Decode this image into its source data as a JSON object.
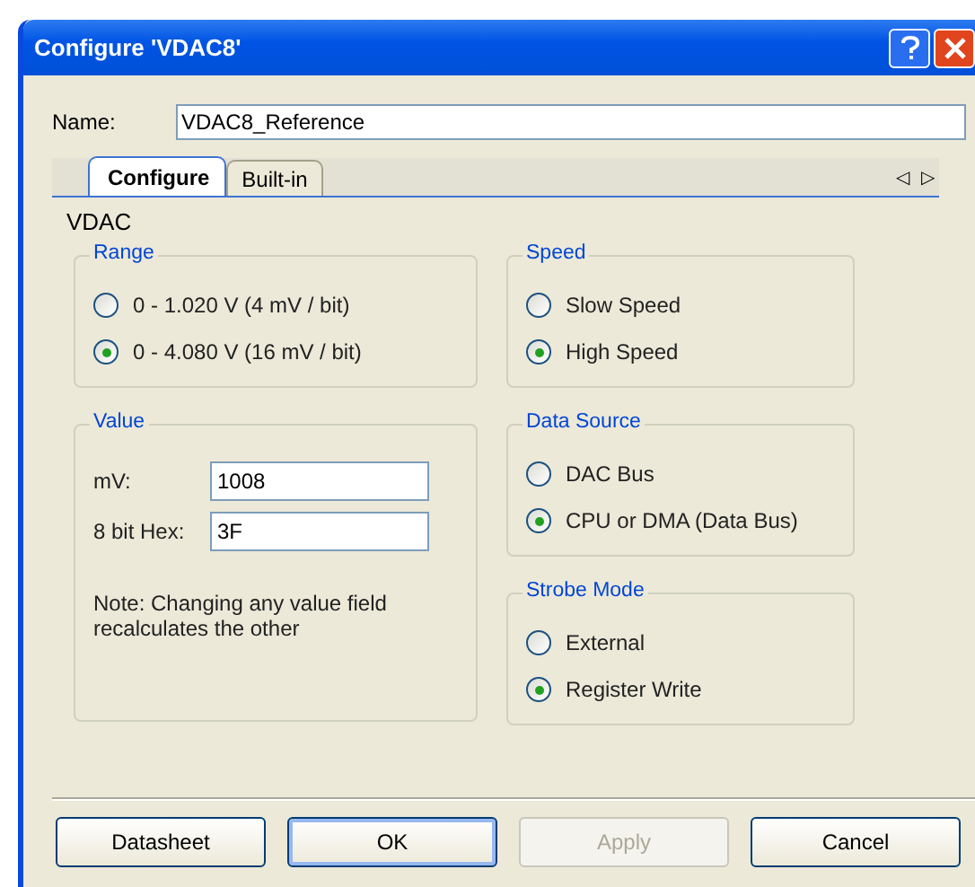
{
  "window": {
    "title": "Configure 'VDAC8'"
  },
  "name_field": {
    "label": "Name:",
    "value": "VDAC8_Reference"
  },
  "tabs": [
    {
      "label": "Configure",
      "selected": true
    },
    {
      "label": "Built-in",
      "selected": false
    }
  ],
  "tab_scroll": [
    "◁",
    "▷"
  ],
  "section_title": "VDAC",
  "range": {
    "title": "Range",
    "options": [
      {
        "label": "0 - 1.020 V (4 mV / bit)",
        "selected": false
      },
      {
        "label": "0 - 4.080 V (16 mV / bit)",
        "selected": true
      }
    ]
  },
  "value": {
    "title": "Value",
    "fields": [
      {
        "label": "mV:",
        "value": "1008"
      },
      {
        "label": "8 bit Hex:",
        "value": "3F"
      }
    ],
    "note": "Note: Changing any value field recalculates the other"
  },
  "speed": {
    "title": "Speed",
    "options": [
      {
        "label": "Slow Speed",
        "selected": false
      },
      {
        "label": "High Speed",
        "selected": true
      }
    ]
  },
  "data_source": {
    "title": "Data Source",
    "options": [
      {
        "label": "DAC Bus",
        "selected": false
      },
      {
        "label": "CPU or DMA (Data Bus)",
        "selected": true
      }
    ]
  },
  "strobe_mode": {
    "title": "Strobe Mode",
    "options": [
      {
        "label": "External",
        "selected": false
      },
      {
        "label": "Register Write",
        "selected": true
      }
    ]
  },
  "buttons": [
    {
      "label": "Datasheet",
      "disabled": false,
      "default": false
    },
    {
      "label": "OK",
      "disabled": false,
      "default": true
    },
    {
      "label": "Apply",
      "disabled": true,
      "default": false
    },
    {
      "label": "Cancel",
      "disabled": false,
      "default": false
    }
  ]
}
